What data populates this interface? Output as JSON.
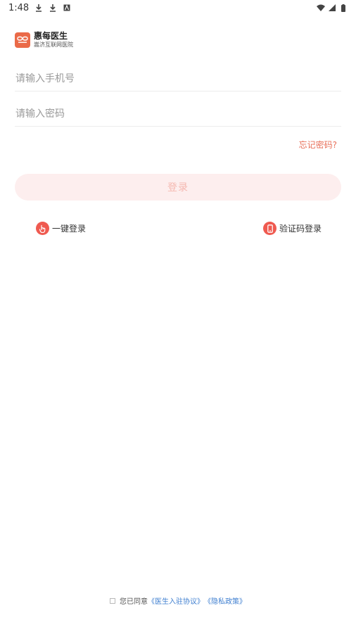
{
  "status_bar": {
    "time": "1:48"
  },
  "brand": {
    "title": "惠每医生",
    "subtitle": "嵩济互联网医院"
  },
  "form": {
    "phone_placeholder": "请输入手机号",
    "password_placeholder": "请输入密码",
    "forgot_label": "忘记密码?",
    "login_label": "登录"
  },
  "alt_login": {
    "oneclick_label": "一键登录",
    "sms_label": "验证码登录"
  },
  "agreement": {
    "prefix": "您已同意",
    "doctor_agreement": "《医生入驻协议》",
    "privacy_policy": "《隐私政策》"
  },
  "colors": {
    "accent": "#ea6a48",
    "login_button_bg": "#fdeeee",
    "link": "#3f7fd0"
  }
}
